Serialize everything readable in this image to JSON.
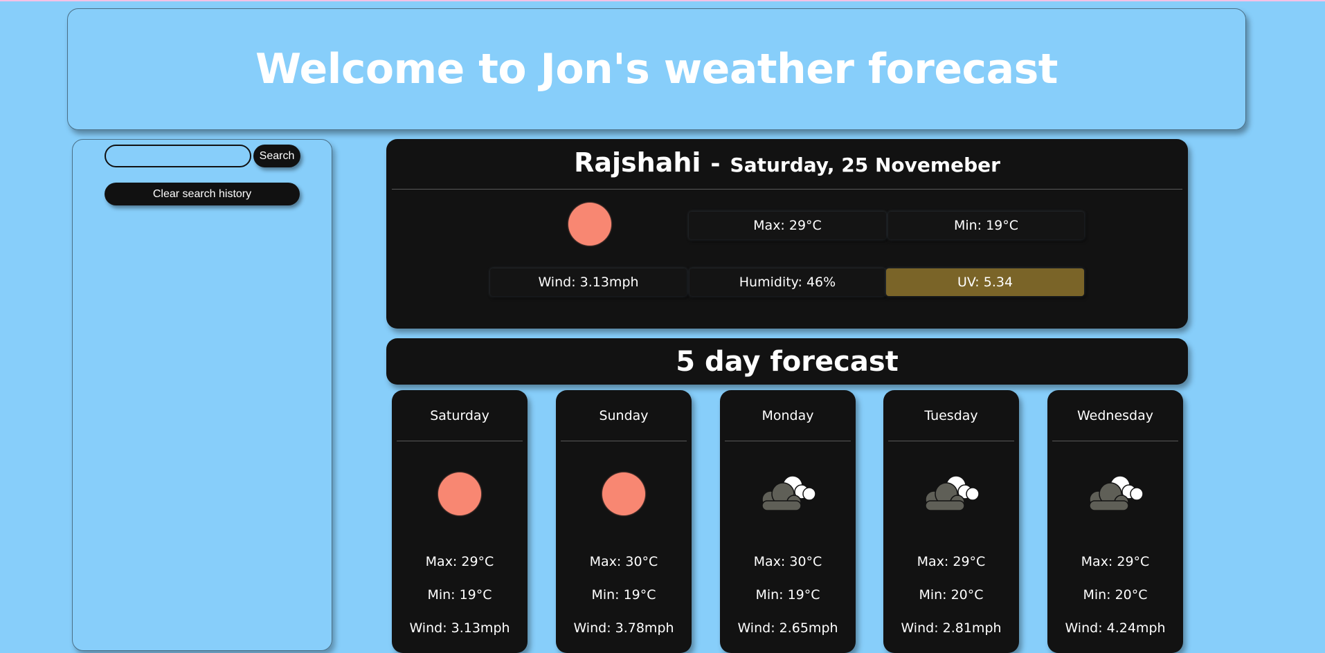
{
  "header": {
    "title": "Welcome to Jon's weather forecast"
  },
  "sidebar": {
    "search_value": "",
    "search_label": "Search",
    "clear_label": "Clear search history"
  },
  "current": {
    "city": "Rajshahi",
    "separator": "-",
    "date": "Saturday, 25 Novemeber",
    "icon": "sun-icon",
    "max": "Max: 29°C",
    "min": "Min: 19°C",
    "wind": "Wind: 3.13mph",
    "humidity": "Humidity: 46%",
    "uv": "UV: 5.34",
    "uv_color": "#7a6428"
  },
  "forecast": {
    "title": "5 day forecast",
    "days": [
      {
        "day": "Saturday",
        "icon": "sun-icon",
        "max": "Max: 29°C",
        "min": "Min: 19°C",
        "wind": "Wind: 3.13mph"
      },
      {
        "day": "Sunday",
        "icon": "sun-icon",
        "max": "Max: 30°C",
        "min": "Min: 19°C",
        "wind": "Wind: 3.78mph"
      },
      {
        "day": "Monday",
        "icon": "cloud-icon",
        "max": "Max: 30°C",
        "min": "Min: 19°C",
        "wind": "Wind: 2.65mph"
      },
      {
        "day": "Tuesday",
        "icon": "cloud-icon",
        "max": "Max: 29°C",
        "min": "Min: 20°C",
        "wind": "Wind: 2.81mph"
      },
      {
        "day": "Wednesday",
        "icon": "cloud-icon",
        "max": "Max: 29°C",
        "min": "Min: 20°C",
        "wind": "Wind: 4.24mph"
      }
    ]
  },
  "colors": {
    "background": "#87cefa",
    "panel": "#121212",
    "sun": "#f88772"
  }
}
